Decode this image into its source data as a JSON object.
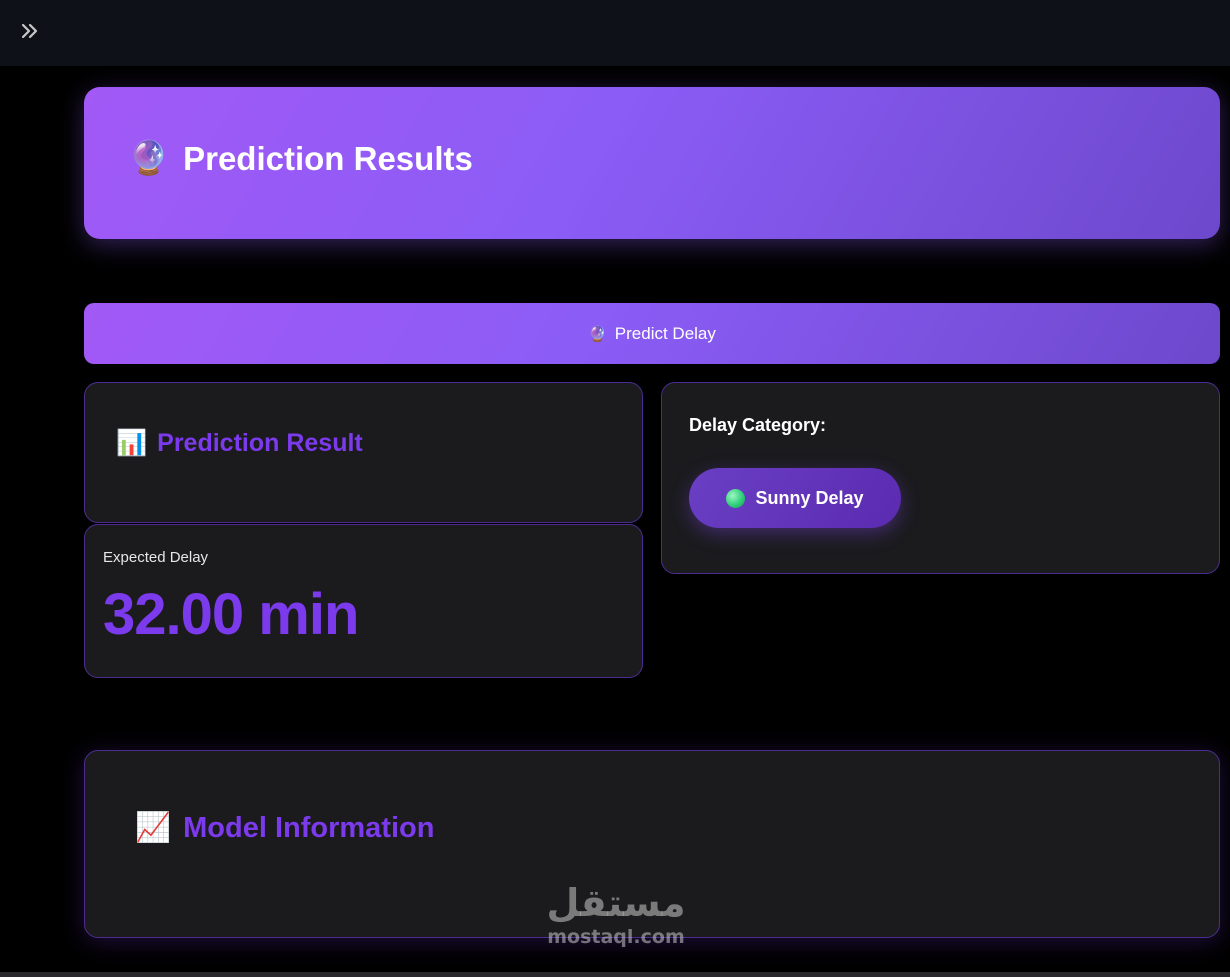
{
  "topbar": {
    "toggle_icon": "double-chevron-right-icon"
  },
  "header": {
    "emoji": "🔮",
    "title": "Prediction Results"
  },
  "predict_button": {
    "emoji": "🔮",
    "label": "Predict Delay"
  },
  "result_card": {
    "emoji": "📊",
    "title": "Prediction Result"
  },
  "metric": {
    "label": "Expected Delay",
    "value": "32.00 min"
  },
  "category": {
    "label": "Delay Category:",
    "badge_label": "Sunny Delay",
    "dot_icon": "green-circle-icon"
  },
  "model_info": {
    "emoji": "📈",
    "title": "Model Information"
  },
  "watermark": {
    "arabic": "مستقل",
    "latin": "mostaql.com"
  },
  "colors": {
    "accent": "#7c3aed",
    "gradient_start": "#a259f6",
    "gradient_end": "#6d48cc",
    "card_bg": "#1b1b1e",
    "topbar_bg": "#0e1117"
  }
}
